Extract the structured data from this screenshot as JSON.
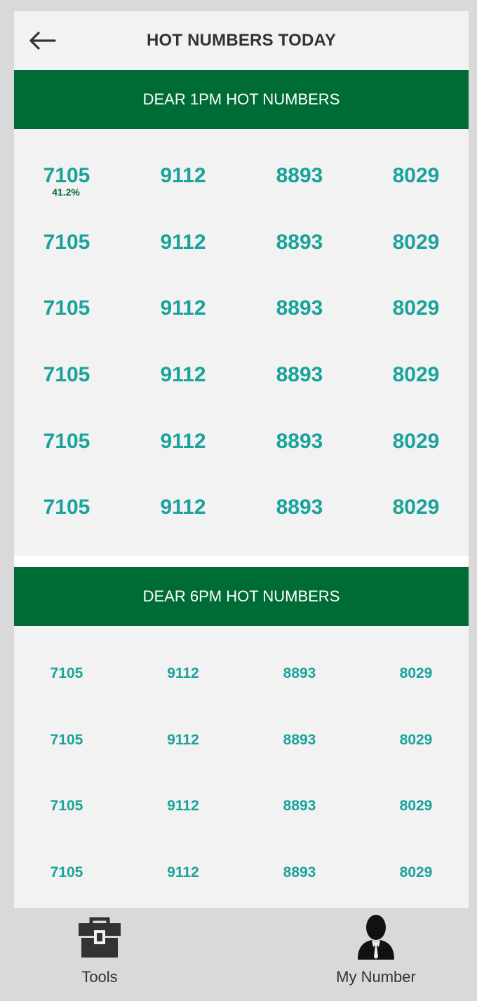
{
  "header": {
    "title": "HOT NUMBERS TODAY",
    "back_icon": "back-arrow-icon"
  },
  "sections": [
    {
      "title": "DEAR 1PM HOT NUMBERS",
      "highlight_percent": "41.2%",
      "rows": [
        [
          "7105",
          "9112",
          "8893",
          "8029"
        ],
        [
          "7105",
          "9112",
          "8893",
          "8029"
        ],
        [
          "7105",
          "9112",
          "8893",
          "8029"
        ],
        [
          "7105",
          "9112",
          "8893",
          "8029"
        ],
        [
          "7105",
          "9112",
          "8893",
          "8029"
        ],
        [
          "7105",
          "9112",
          "8893",
          "8029"
        ]
      ]
    },
    {
      "title": "DEAR 6PM HOT NUMBERS",
      "rows": [
        [
          "7105",
          "9112",
          "8893",
          "8029"
        ],
        [
          "7105",
          "9112",
          "8893",
          "8029"
        ],
        [
          "7105",
          "9112",
          "8893",
          "8029"
        ],
        [
          "7105",
          "9112",
          "8893",
          "8029"
        ]
      ]
    }
  ],
  "bottom_nav": {
    "tools_label": "Tools",
    "tools_icon": "toolbox-icon",
    "my_number_label": "My Number",
    "my_number_icon": "user-icon"
  },
  "colors": {
    "header_green": "#006c35",
    "number_teal": "#1aa39b",
    "percent_green": "#006c35"
  }
}
